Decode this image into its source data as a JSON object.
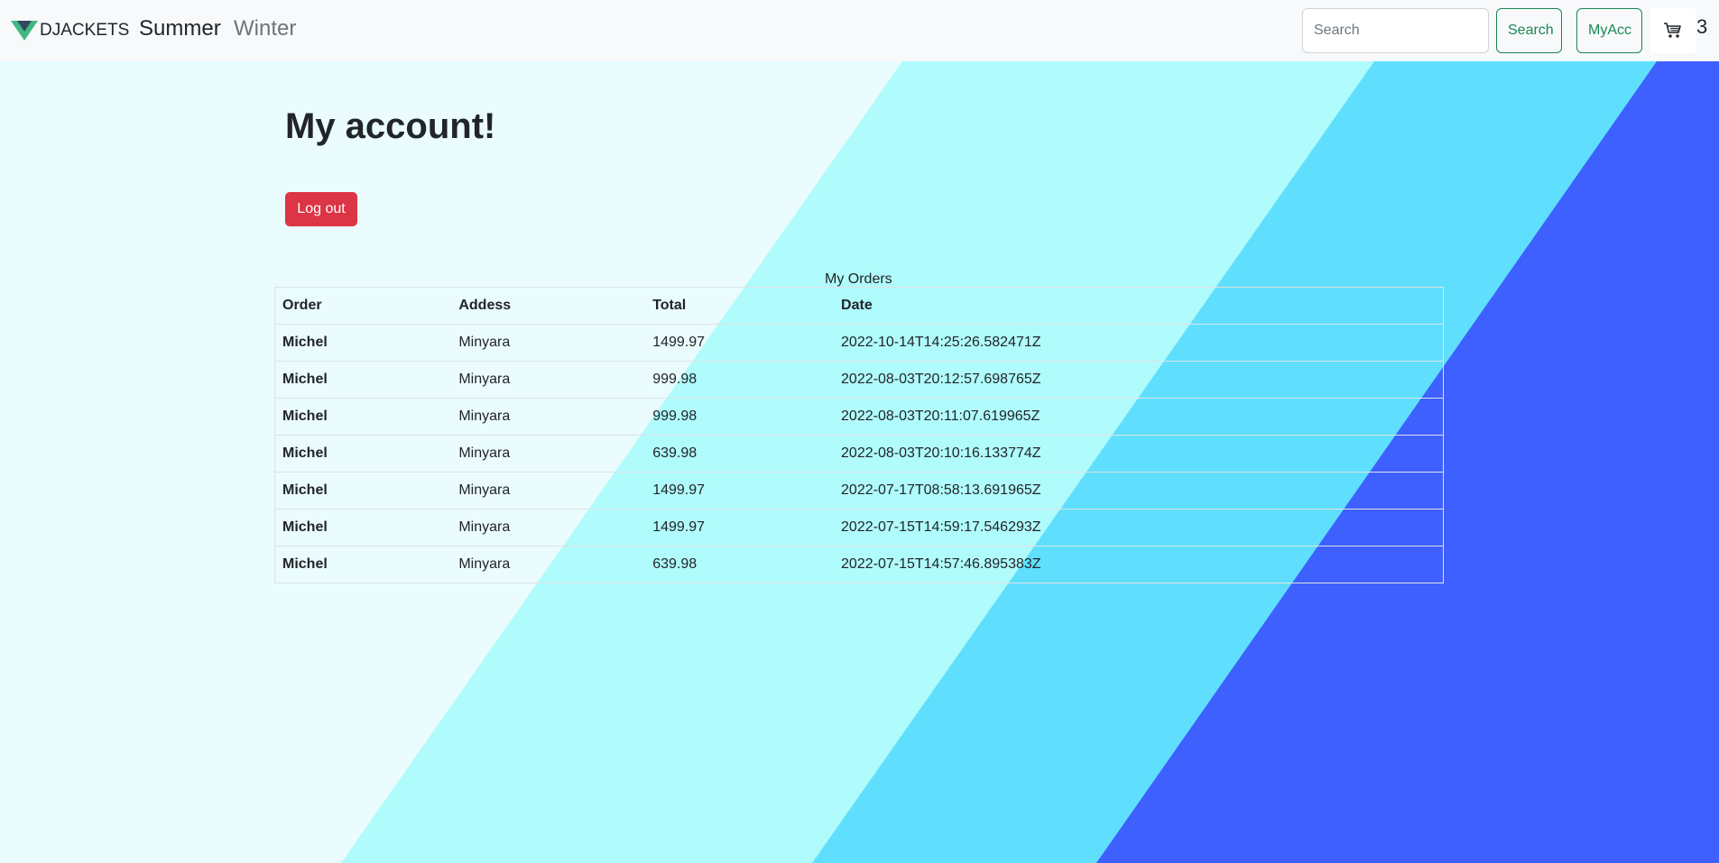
{
  "colors": {
    "bg_light": "#eafcfd",
    "band_1": "#b0fbfc",
    "band_2": "#5fdffd",
    "band_3": "#3e60ff",
    "navbar_bg": "#f8f9fa",
    "accent_green": "#198754",
    "logout_red": "#dc3545"
  },
  "navbar": {
    "brand": "DJACKETS",
    "links": [
      {
        "label": "Summer",
        "active": true
      },
      {
        "label": "Winter",
        "active": false
      }
    ],
    "search": {
      "placeholder": "Search",
      "value": ""
    },
    "search_button": "Search",
    "account_button": "MyAcc",
    "cart_icon": "cart-icon",
    "cart_count": "3"
  },
  "main": {
    "title": "My account!",
    "logout_label": "Log out",
    "orders_heading": "My Orders",
    "table": {
      "headers": [
        "Order",
        "Addess",
        "Total",
        "Date"
      ],
      "rows": [
        {
          "order": "Michel",
          "address": "Minyara",
          "total": "1499.97",
          "date": "2022-10-14T14:25:26.582471Z"
        },
        {
          "order": "Michel",
          "address": "Minyara",
          "total": "999.98",
          "date": "2022-08-03T20:12:57.698765Z"
        },
        {
          "order": "Michel",
          "address": "Minyara",
          "total": "999.98",
          "date": "2022-08-03T20:11:07.619965Z"
        },
        {
          "order": "Michel",
          "address": "Minyara",
          "total": "639.98",
          "date": "2022-08-03T20:10:16.133774Z"
        },
        {
          "order": "Michel",
          "address": "Minyara",
          "total": "1499.97",
          "date": "2022-07-17T08:58:13.691965Z"
        },
        {
          "order": "Michel",
          "address": "Minyara",
          "total": "1499.97",
          "date": "2022-07-15T14:59:17.546293Z"
        },
        {
          "order": "Michel",
          "address": "Minyara",
          "total": "639.98",
          "date": "2022-07-15T14:57:46.895383Z"
        }
      ]
    }
  }
}
